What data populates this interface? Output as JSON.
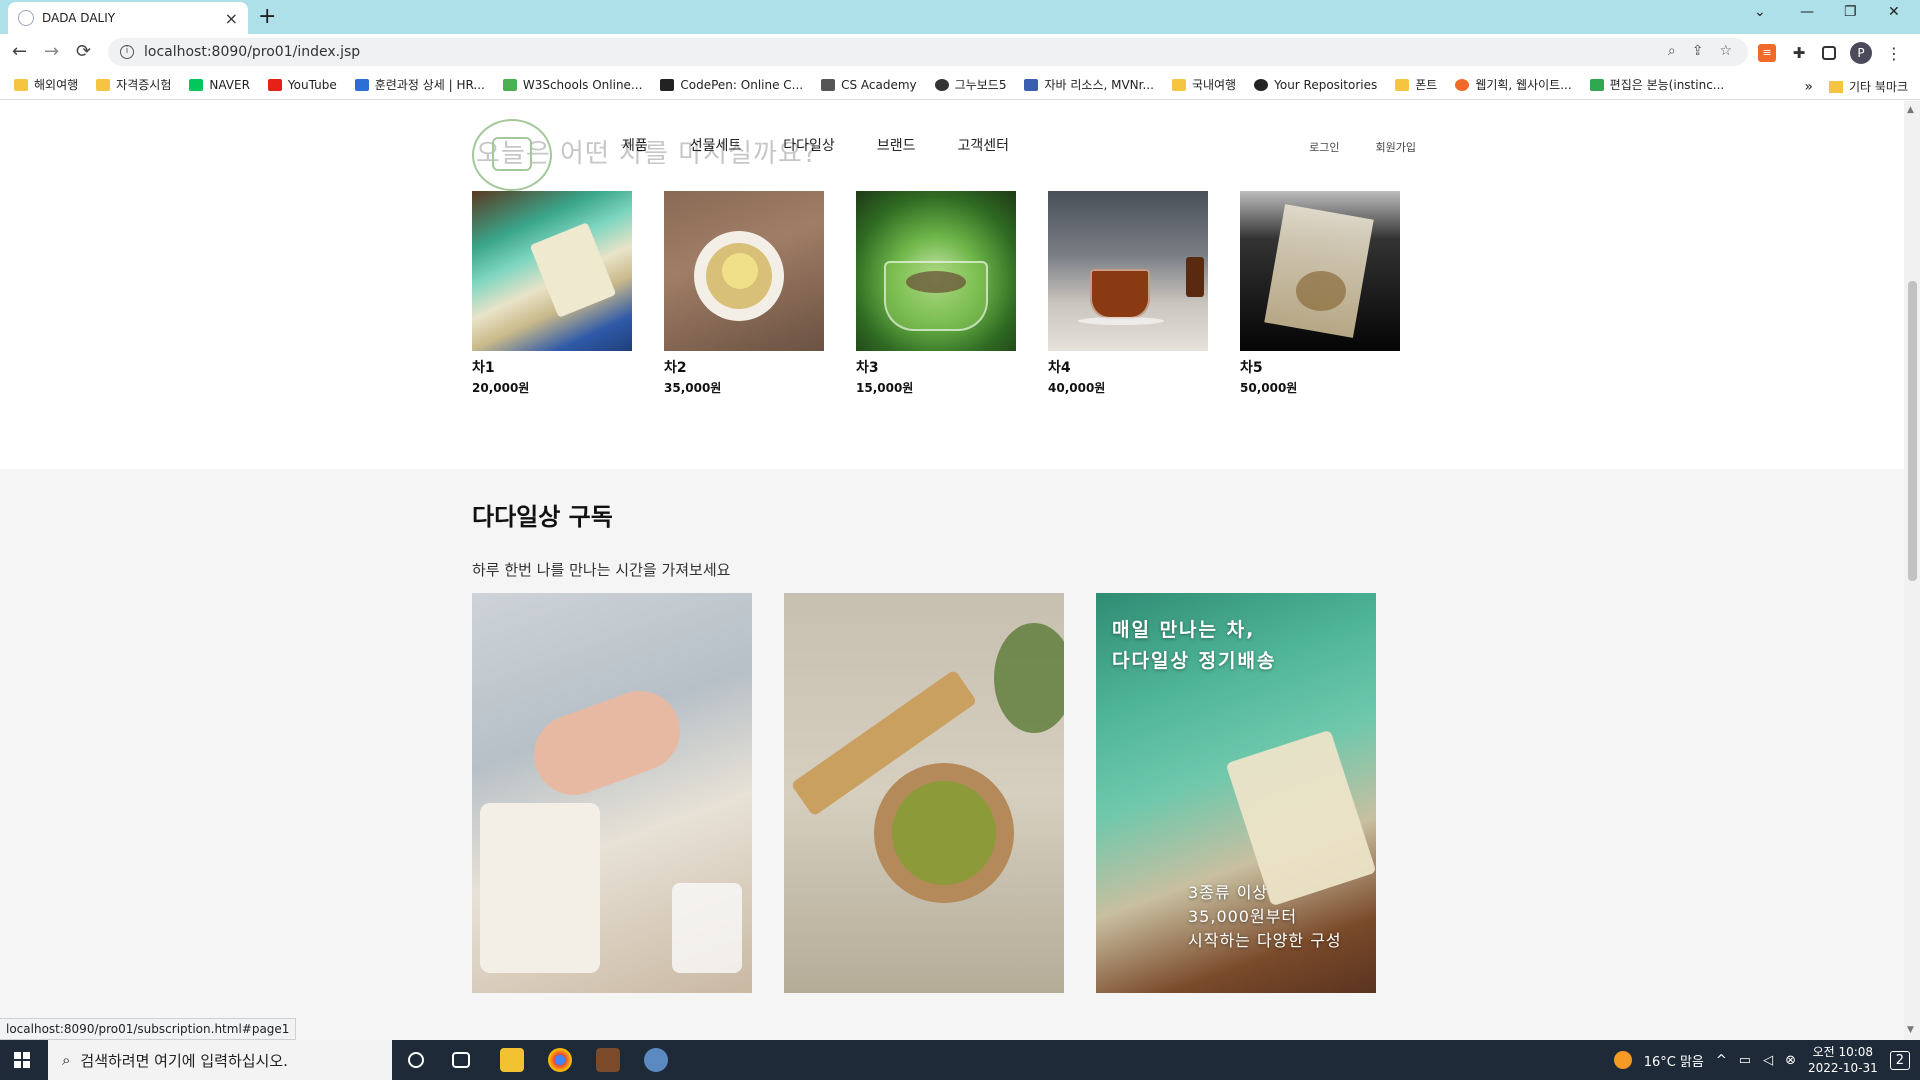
{
  "browser": {
    "tab_title": "DADA DALIY",
    "url": "localhost:8090/pro01/index.jsp",
    "bookmarks": [
      "해외여행",
      "자격증시험",
      "NAVER",
      "YouTube",
      "훈련과정 상세 | HR...",
      "W3Schools Online...",
      "CodePen: Online C...",
      "CS Academy",
      "그누보드5",
      "자바 리소스, MVNr...",
      "국내여행",
      "Your Repositories",
      "폰트",
      "웹기획, 웹사이트...",
      "편집은 본능(instinc..."
    ],
    "bookmarks_more": "»",
    "other_bookmarks": "기타 북마크",
    "profile_initial": "P",
    "status_url": "localhost:8090/pro01/subscription.html#page1"
  },
  "page": {
    "nav": [
      "제품",
      "선물세트",
      "다다일상",
      "브랜드",
      "고객센터"
    ],
    "user": [
      "로그인",
      "회원가입"
    ],
    "faded_heading": "오늘은 어떤 차를 마시실까요?",
    "products": [
      {
        "name": "차1",
        "price": "20,000원"
      },
      {
        "name": "차2",
        "price": "35,000원"
      },
      {
        "name": "차3",
        "price": "15,000원"
      },
      {
        "name": "차4",
        "price": "40,000원"
      },
      {
        "name": "차5",
        "price": "50,000원"
      }
    ],
    "subscription": {
      "title": "다다일상 구독",
      "desc": "하루 한번 나를 만나는 시간을 가져보세요",
      "card3_head": [
        "매일 만나는 차,",
        "다다일상 정기배송"
      ],
      "card3_foot": [
        "3종류 이상",
        "35,000원부터",
        "시작하는 다양한 구성"
      ]
    }
  },
  "taskbar": {
    "search_placeholder": "검색하려면 여기에 입력하십시오.",
    "weather": "16°C 맑음",
    "time": "오전 10:08",
    "date": "2022-10-31",
    "notifications": "2"
  },
  "colors": {
    "tabbar": "#aee0ea",
    "taskbar": "#1e2a38",
    "logo": "#a4c79c",
    "section_bg": "#f5f5f5"
  }
}
